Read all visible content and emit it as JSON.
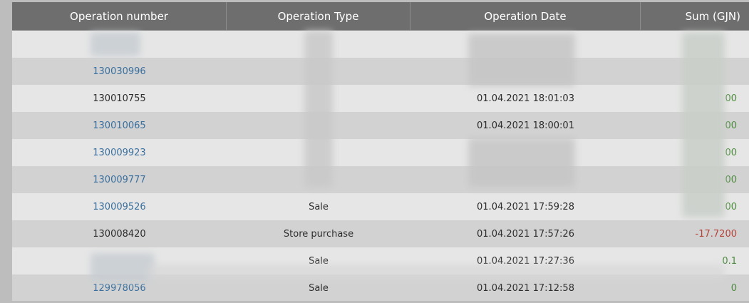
{
  "table": {
    "headers": [
      "Operation number",
      "Operation Type",
      "Operation Date",
      "Sum (GJN)"
    ],
    "rows": [
      {
        "number": "",
        "type": "",
        "date": "",
        "sum": "",
        "link": false,
        "tone": "light",
        "sign": ""
      },
      {
        "number": "130030996",
        "type": "",
        "date": "",
        "sum": "",
        "link": true,
        "tone": "dark",
        "sign": ""
      },
      {
        "number": "130010755",
        "type": "",
        "date": "01.04.2021 18:01:03",
        "sum": "00",
        "link": false,
        "tone": "light",
        "sign": "pos"
      },
      {
        "number": "130010065",
        "type": "",
        "date": "01.04.2021 18:00:01",
        "sum": "00",
        "link": true,
        "tone": "dark",
        "sign": "pos"
      },
      {
        "number": "130009923",
        "type": "",
        "date": "",
        "sum": "00",
        "link": true,
        "tone": "light",
        "sign": "pos"
      },
      {
        "number": "130009777",
        "type": "",
        "date": "",
        "sum": "00",
        "link": true,
        "tone": "dark",
        "sign": "pos"
      },
      {
        "number": "130009526",
        "type": "Sale",
        "date": "01.04.2021 17:59:28",
        "sum": "00",
        "link": true,
        "tone": "light",
        "sign": "pos"
      },
      {
        "number": "130008420",
        "type": "Store purchase",
        "date": "01.04.2021 17:57:26",
        "sum": "-17.7200",
        "link": false,
        "tone": "dark",
        "sign": "neg"
      },
      {
        "number": "",
        "type": "Sale",
        "date": "01.04.2021 17:27:36",
        "sum": "0.1",
        "link": true,
        "tone": "light",
        "sign": "pos"
      },
      {
        "number": "129978056",
        "type": "Sale",
        "date": "01.04.2021 17:12:58",
        "sum": "0",
        "link": true,
        "tone": "dark",
        "sign": "pos"
      }
    ]
  }
}
